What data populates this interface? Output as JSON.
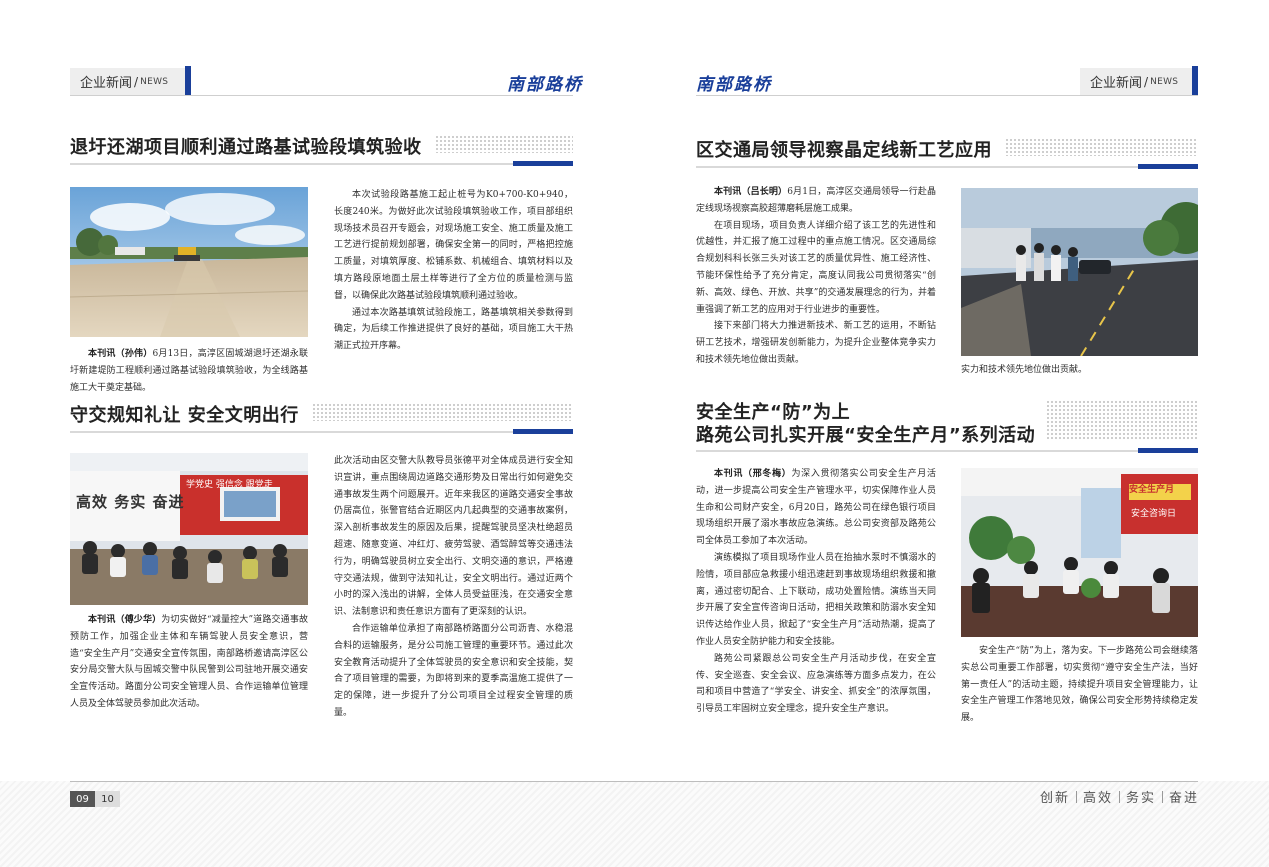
{
  "header": {
    "section_zh": "企业新闻",
    "section_sep": "/",
    "section_en": "NEWS",
    "brand": "南部路桥"
  },
  "left": {
    "article1": {
      "title": "退圩还湖项目顺利通过路基试验段填筑验收",
      "lead": "本刊讯（孙伟）",
      "p1": "6月13日，高淳区固城湖退圩还湖永联圩新建堤防工程顺利通过路基试验段填筑验收，为全线路基施工大干奠定基础。",
      "p2": "本次试验段路基施工起止桩号为K0+700-K0+940，长度240米。为做好此次试验段填筑验收工作，项目部组织现场技术员召开专题会，对现场施工安全、施工质量及施工工艺进行提前规划部署，确保安全第一的同时，严格把控施工质量，对填筑厚度、松铺系数、机械组合、填筑材料以及填方路段原地面土层土样等进行了全方位的质量检测与监督，以确保此次路基试验段填筑顺利通过验收。",
      "p3": "通过本次路基填筑试验段施工，路基填筑相关参数得到确定，为后续工作推进提供了良好的基础，项目施工大干热潮正式拉开序幕。"
    },
    "article2": {
      "title": "守交规知礼让  安全文明出行",
      "lead": "本刊讯（傅少华）",
      "p1": "为切实做好“减量控大”道路交通事故预防工作，加强企业主体和车辆驾驶人员安全意识，营造“安全生产月”交通安全宣传氛围，南部路桥邀请高淳区公安分局交警大队与固城交警中队民警到公司驻地开展交通安全宣传活动。路面分公司安全管理人员、合作运输单位管理人员及全体驾驶员参加此次活动。",
      "p2": "此次活动由区交警大队教导员张德平对全体成员进行安全知识宣讲，重点围绕周边道路交通形势及日常出行如何避免交通事故发生两个问题展开。近年来我区的道路交通安全事故仍居高位，张警官结合近期区内几起典型的交通事故案例，深入剖析事故发生的原因及后果，提醒驾驶员坚决杜绝超员超速、随意变道、冲红灯、疲劳驾驶、酒驾醉驾等交通违法行为，明确驾驶员树立安全出行、文明交通的意识，严格遵守交通法规，做到守法知礼让，安全文明出行。通过近两个小时的深入浅出的讲解，全体人员受益匪浅，在交通安全意识、法制意识和责任意识方面有了更深刻的认识。",
      "p3": "合作运输单位承担了南部路桥路面分公司沥青、水稳混合料的运输服务，是分公司施工管理的重要环节。通过此次安全教育活动提升了全体驾驶员的安全意识和安全技能，契合了项目管理的需要，为即将到来的夏季高温施工提供了一定的保障，进一步提升了分公司项目全过程安全管理的质量。",
      "banner_text": "高效  务实  奋进",
      "wall_text": "学党史  强信念  跟党走"
    },
    "page_number": "09"
  },
  "right": {
    "article1": {
      "title": "区交通局领导视察晶定线新工艺应用",
      "lead": "本刊讯（吕长明）",
      "p1": "6月1日，高淳区交通局领导一行赴晶定线现场视察高胶超薄磨耗层施工成果。",
      "p2": "在项目现场，项目负责人详细介绍了该工艺的先进性和优越性，并汇报了施工过程中的重点施工情况。区交通局综合规划科科长张三头对该工艺的质量优异性、施工经济性、节能环保性给予了充分肯定，高度认同我公司贯彻落实“创新、高效、绿色、开放、共享”的交通发展理念的行为，并着重强调了新工艺的应用对于行业进步的重要性。",
      "p3": "接下来部门将大力推进新技术、新工艺的运用，不断钻研工艺技术，增强研发创新能力，为提升企业整体竞争实力和技术领先地位做出贡献。"
    },
    "article2": {
      "title_line1": "安全生产“防”为上",
      "title_line2": "路苑公司扎实开展“安全生产月”系列活动",
      "lead": "本刊讯（邢冬梅）",
      "p1": "为深入贯彻落实公司安全生产月活动，进一步提高公司安全生产管理水平，切实保障作业人员生命和公司财产安全，6月20日，路苑公司在绿色银行项目现场组织开展了溺水事故应急演练。总公司安资部及路苑公司全体员工参加了本次活动。",
      "p2": "演练模拟了项目现场作业人员在抬抽水泵时不慎溺水的险情，项目部应急救援小组迅速赶到事故现场组织救援和撤离，通过密切配合、上下联动，成功处置险情。演练当天同步开展了安全宣传咨询日活动，把相关政策和防溺水安全知识传达给作业人员，掀起了“安全生产月”活动热潮，提高了作业人员安全防护能力和安全技能。",
      "p3": "路苑公司紧跟总公司安全生产月活动步伐，在安全宣传、安全巡查、安全会议、应急演练等方面多点发力，在公司和项目中营造了“学安全、讲安全、抓安全”的浓厚氛围，引导员工牢固树立安全理念，提升安全生产意识。",
      "p4": "安全生产“防”为上，落为安。下一步路苑公司会继续落实总公司重要工作部署，切实贯彻“遵守安全生产法，当好第一责任人”的活动主题，持续提升项目安全管理能力，让安全生产管理工作落地见效，确保公司安全形势持续稳定发展。",
      "banner_text": "安全生产月",
      "board_text": "安全咨询日"
    },
    "page_number": "10"
  },
  "footer": {
    "slogan": [
      "创新",
      "高效",
      "务实",
      "奋进"
    ]
  },
  "colors": {
    "accent_blue": "#1a3f9a",
    "tab_grey": "#eeeeee",
    "text": "#2e2e2e"
  }
}
